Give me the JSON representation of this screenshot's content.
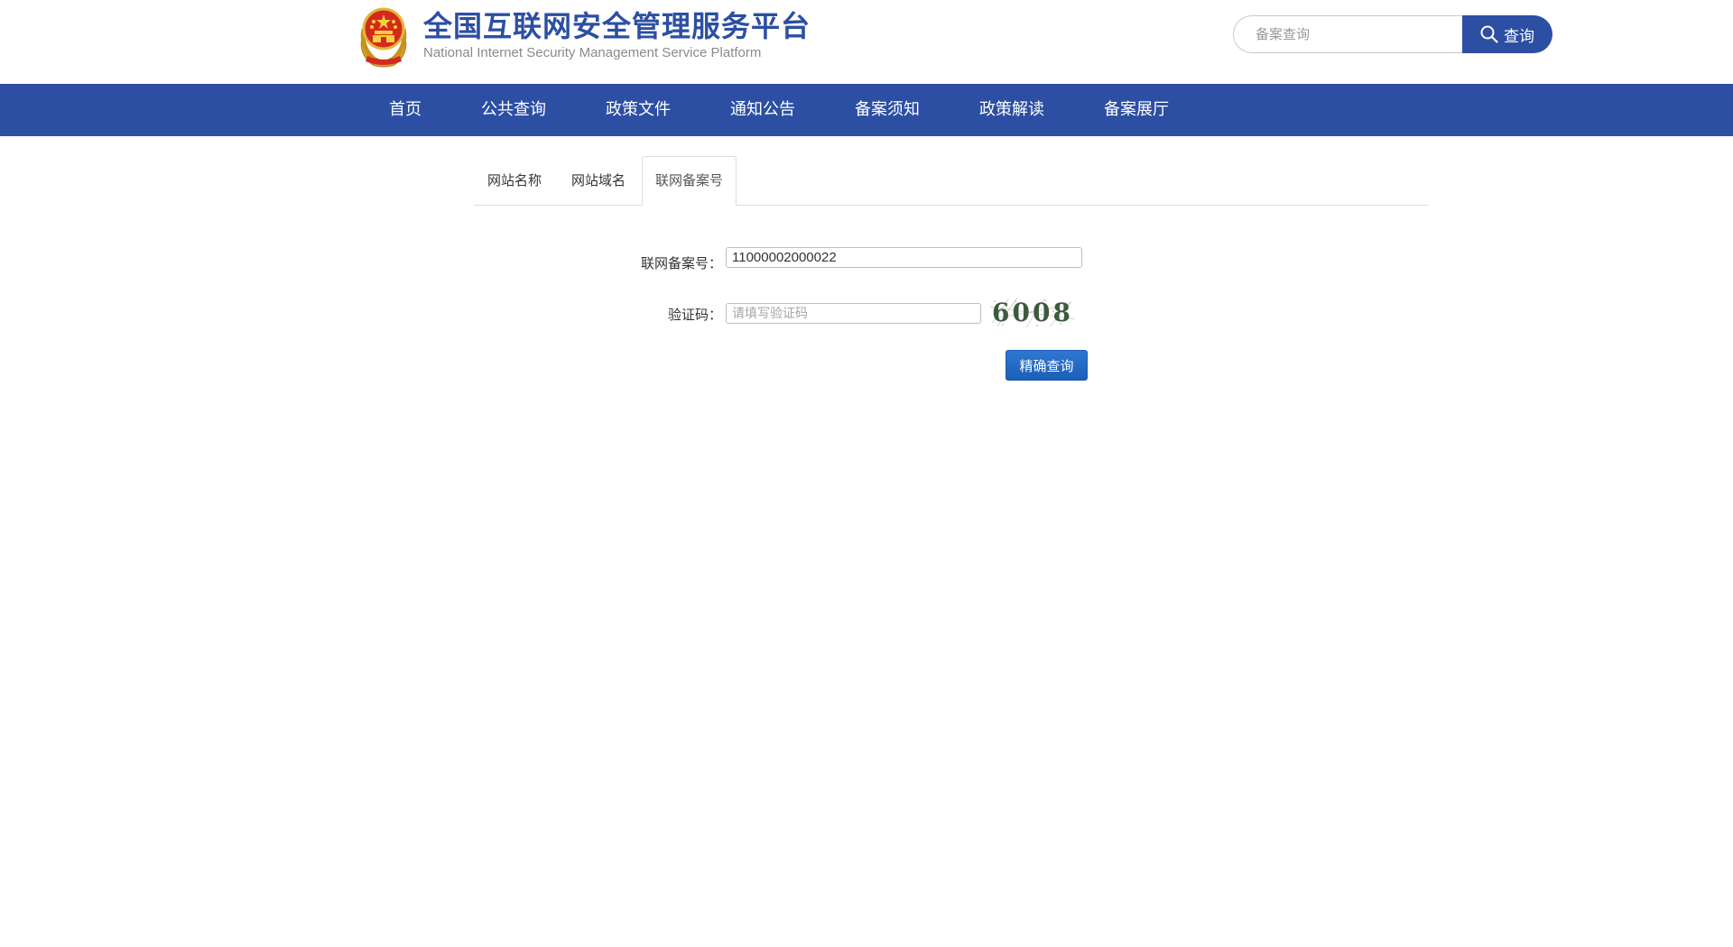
{
  "header": {
    "title_cn": "全国互联网安全管理服务平台",
    "title_en": "National Internet Security Management Service Platform",
    "search": {
      "placeholder": "备案查询",
      "value": "",
      "button_label": "查询"
    }
  },
  "nav": {
    "items": [
      {
        "label": "首页"
      },
      {
        "label": "公共查询"
      },
      {
        "label": "政策文件"
      },
      {
        "label": "通知公告"
      },
      {
        "label": "备案须知"
      },
      {
        "label": "政策解读"
      },
      {
        "label": "备案展厅"
      }
    ]
  },
  "tabs": {
    "items": [
      {
        "label": "网站名称",
        "active": false
      },
      {
        "label": "网站域名",
        "active": false
      },
      {
        "label": "联网备案号",
        "active": true
      }
    ]
  },
  "form": {
    "record_number_label": "联网备案号：",
    "record_number_value": "11000002000022",
    "captcha_label": "验证码：",
    "captcha_placeholder": "请填写验证码",
    "captcha_value": "",
    "captcha_digits": "6008",
    "submit_label": "精确查询"
  },
  "colors": {
    "brand_blue": "#2c4fa3",
    "button_blue": "#1f66c0"
  }
}
